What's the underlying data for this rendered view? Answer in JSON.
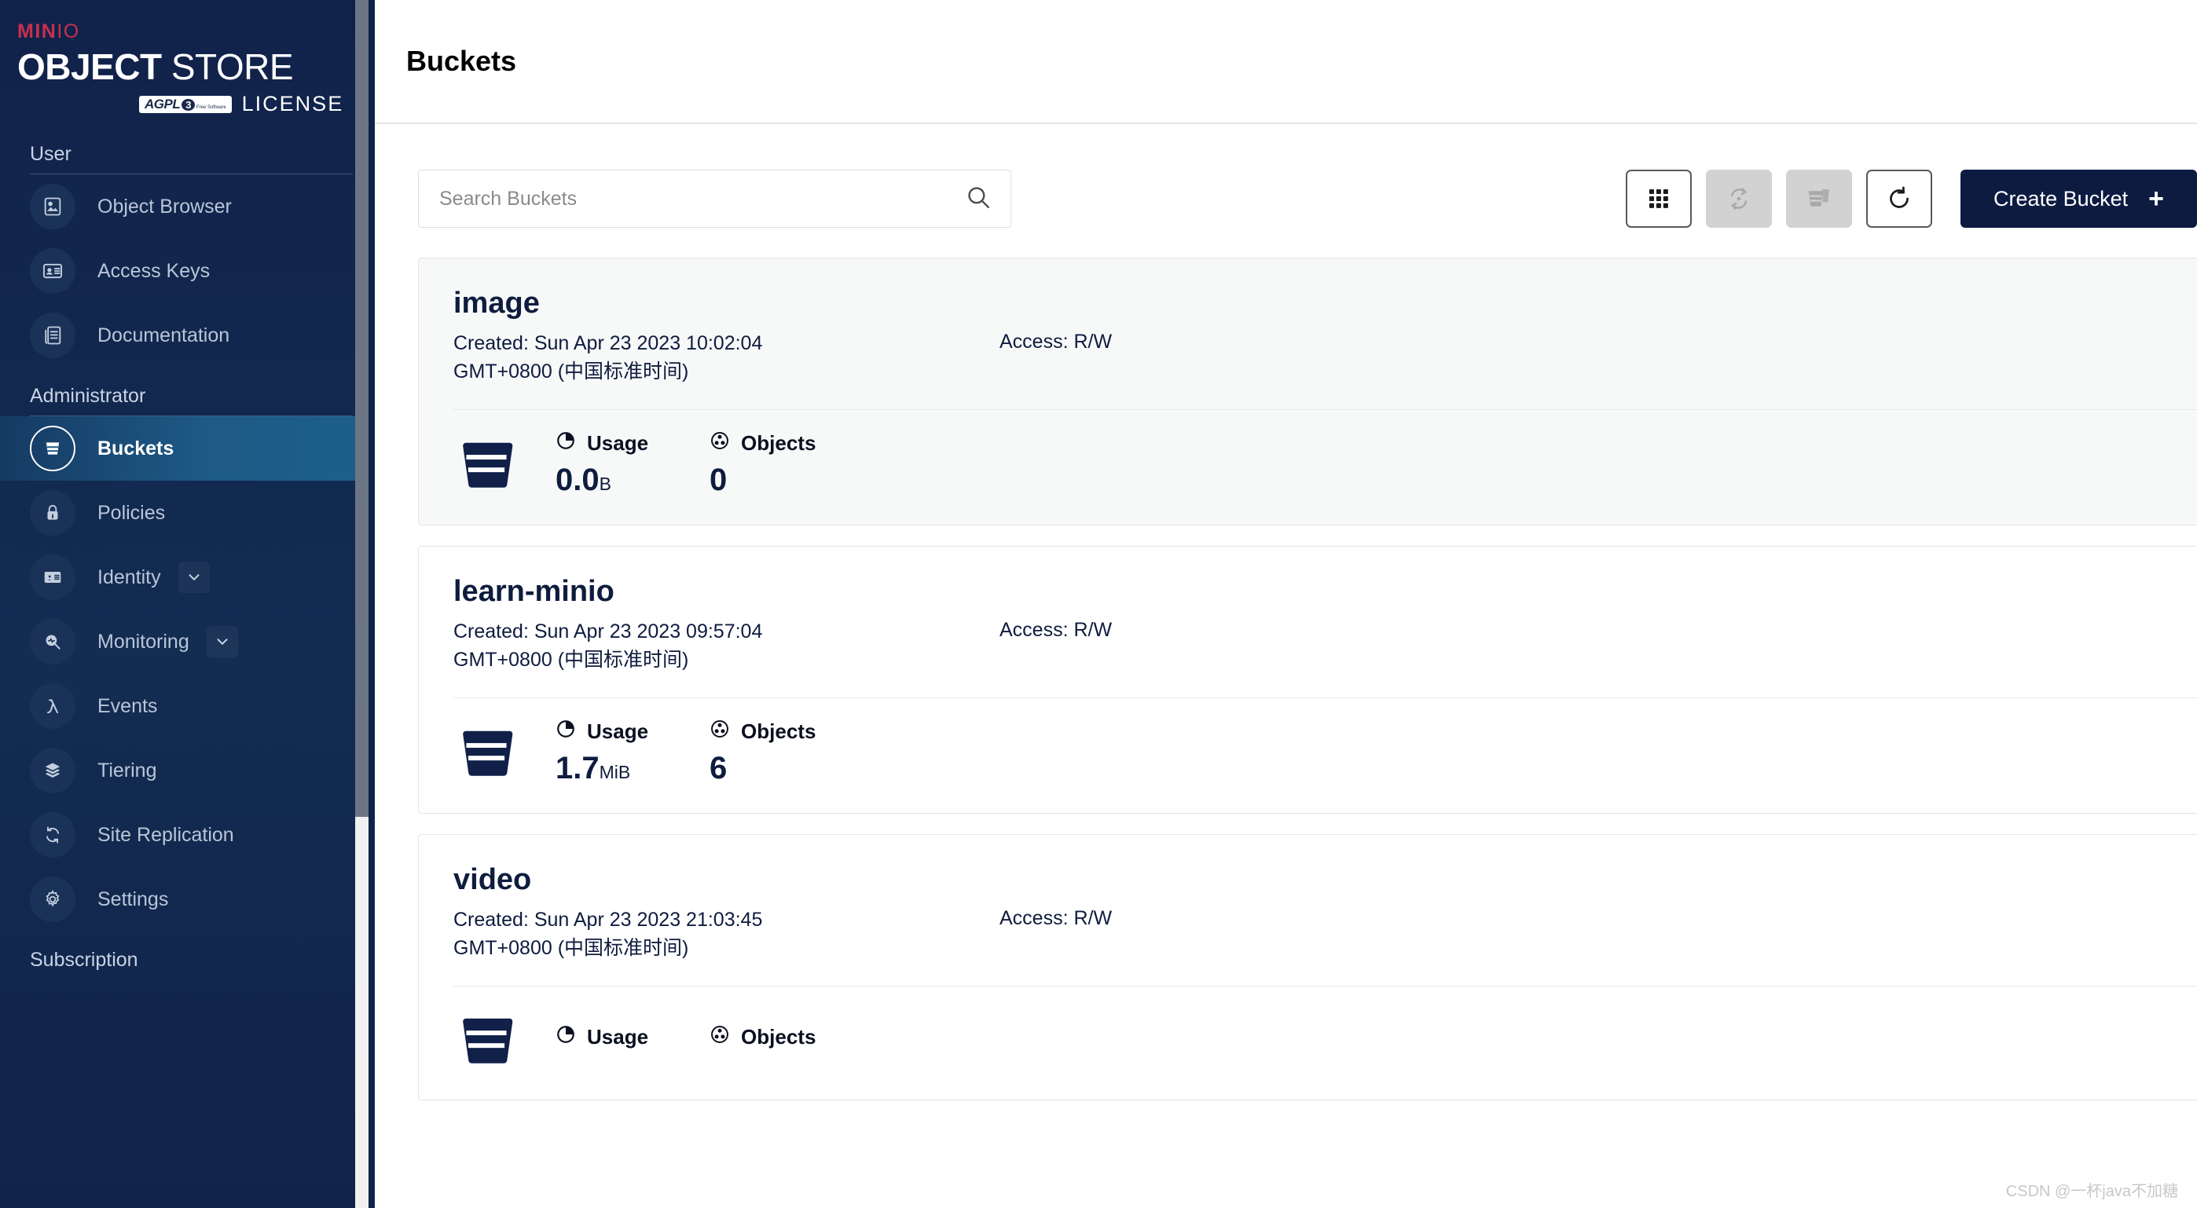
{
  "sidebar": {
    "logo": {
      "brand_prefix": "MIN",
      "brand_suffix": "IO",
      "title_bold": "OBJECT",
      "title_light": "STORE",
      "agpl_main": "AGPL",
      "agpl_version": "3",
      "agpl_sub": "Free Software",
      "license_word": "LICENSE"
    },
    "sections": [
      {
        "title": "User"
      },
      {
        "title": "Administrator"
      },
      {
        "title": "Subscription"
      }
    ],
    "user_items": [
      {
        "label": "Object Browser",
        "icon": "object-browser-icon"
      },
      {
        "label": "Access Keys",
        "icon": "access-keys-icon"
      },
      {
        "label": "Documentation",
        "icon": "documentation-icon"
      }
    ],
    "admin_items": [
      {
        "label": "Buckets",
        "icon": "bucket-icon",
        "active": true,
        "chevron": false
      },
      {
        "label": "Policies",
        "icon": "lock-icon",
        "active": false,
        "chevron": false
      },
      {
        "label": "Identity",
        "icon": "identity-icon",
        "active": false,
        "chevron": true
      },
      {
        "label": "Monitoring",
        "icon": "monitoring-icon",
        "active": false,
        "chevron": true
      },
      {
        "label": "Events",
        "icon": "lambda-icon",
        "active": false,
        "chevron": false
      },
      {
        "label": "Tiering",
        "icon": "layers-icon",
        "active": false,
        "chevron": false
      },
      {
        "label": "Site Replication",
        "icon": "replication-icon",
        "active": false,
        "chevron": false
      },
      {
        "label": "Settings",
        "icon": "gear-icon",
        "active": false,
        "chevron": false
      }
    ]
  },
  "header": {
    "title": "Buckets"
  },
  "toolbar": {
    "search_placeholder": "Search Buckets",
    "search_value": "",
    "search_icon": "search-icon",
    "buttons": [
      {
        "name": "grid-view-button",
        "icon": "grid-icon",
        "disabled": false
      },
      {
        "name": "replication-button",
        "icon": "sync-arrows-icon",
        "disabled": true
      },
      {
        "name": "delete-buckets-button",
        "icon": "multi-bucket-icon",
        "disabled": true
      },
      {
        "name": "refresh-button",
        "icon": "refresh-icon",
        "disabled": false
      }
    ],
    "create_label": "Create Bucket",
    "create_plus": "+"
  },
  "labels": {
    "created_prefix": "Created: ",
    "access_prefix": "Access: ",
    "usage": "Usage",
    "objects": "Objects"
  },
  "buckets": [
    {
      "name": "image",
      "created_line1": "Created: Sun Apr 23 2023 10:02:04",
      "created_line2": "GMT+0800 (中国标准时间)",
      "access": "Access: R/W",
      "usage_value": "0.0",
      "usage_unit": "B",
      "objects": "0",
      "hover": true
    },
    {
      "name": "learn-minio",
      "created_line1": "Created: Sun Apr 23 2023 09:57:04",
      "created_line2": "GMT+0800 (中国标准时间)",
      "access": "Access: R/W",
      "usage_value": "1.7",
      "usage_unit": "MiB",
      "objects": "6",
      "hover": false
    },
    {
      "name": "video",
      "created_line1": "Created: Sun Apr 23 2023 21:03:45",
      "created_line2": "GMT+0800 (中国标准时间)",
      "access": "Access: R/W",
      "usage_value": "",
      "usage_unit": "",
      "objects": "",
      "hover": false
    }
  ],
  "watermark": "CSDN @一杯java不加糖",
  "colors": {
    "sidebar_bg": "#11224a",
    "brand_red": "#c8304f",
    "active_nav": "#1d5f8c",
    "navy": "#0d1b41"
  }
}
